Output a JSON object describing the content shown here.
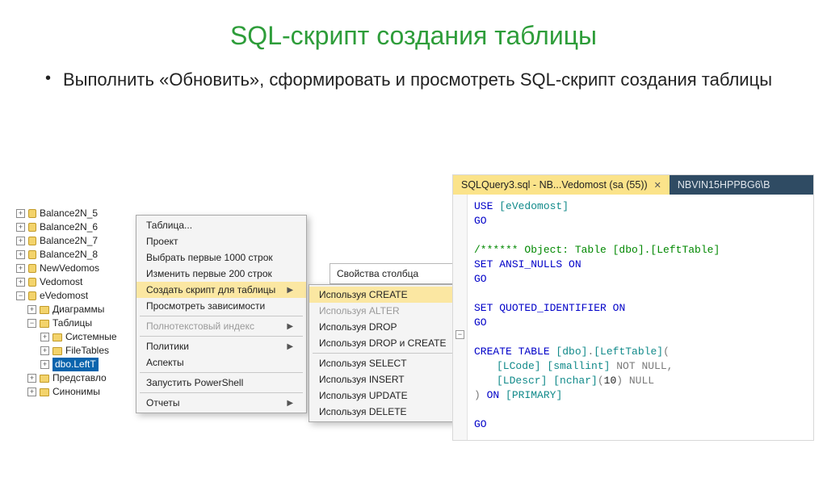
{
  "title": "SQL-скрипт создания таблицы",
  "bullet": "Выполнить «Обновить», сформировать и просмотреть SQL-скрипт создания таблицы",
  "tree": {
    "n0": "Balance2N_5",
    "n1": "Balance2N_6",
    "n2": "Balance2N_7",
    "n3": "Balance2N_8",
    "n4": "NewVedomos",
    "n5": "Vedomost",
    "n6": "eVedomost",
    "n7": "Диаграммы",
    "n8": "Таблицы",
    "n9": "Системные",
    "n10": "FileTables",
    "n11": "dbo.LeftT",
    "n12": "Представло",
    "n13": "Синонимы"
  },
  "colprops": "Свойства столбца",
  "menu1": {
    "i0": "Таблица...",
    "i1": "Проект",
    "i2": "Выбрать первые 1000 строк",
    "i3": "Изменить первые 200 строк",
    "i4": "Создать скрипт для таблицы",
    "i5": "Просмотреть зависимости",
    "i6": "Полнотекстовый индекс",
    "i7": "Политики",
    "i8": "Аспекты",
    "i9": "Запустить PowerShell",
    "i10": "Отчеты"
  },
  "menu2": {
    "i0": "Используя CREATE",
    "i1": "Используя ALTER",
    "i2": "Используя DROP",
    "i3": "Используя DROP и CREATE",
    "i4": "Используя SELECT",
    "i5": "Используя INSERT",
    "i6": "Используя UPDATE",
    "i7": "Используя DELETE"
  },
  "editor": {
    "tab1": "SQLQuery3.sql - NB...Vedomost (sa (55))",
    "tab2": "NBVIN15HPPBG6\\B",
    "lines": {
      "l0a": "USE ",
      "l0b": "[eVedomost]",
      "l1": "GO",
      "l2a": "/****** Object:  Table [dbo].[LeftTable]",
      "l3a": "SET ",
      "l3b": "ANSI_NULLS ",
      "l3c": "ON",
      "l4": "GO",
      "l5a": "SET ",
      "l5b": "QUOTED_IDENTIFIER ",
      "l5c": "ON",
      "l6": "GO",
      "l7a": "CREATE ",
      "l7b": "TABLE ",
      "l7c": "[dbo]",
      "l7d": ".",
      "l7e": "[LeftTable]",
      "l7f": "(",
      "l8a": "[LCode] [smallint] ",
      "l8b": "NOT NULL",
      "l8c": ",",
      "l9a": "[LDescr] [nchar]",
      "l9b": "(",
      "l9c": "10",
      "l9d": ") ",
      "l9e": "NULL",
      "l10a": ")",
      "l10b": " ON ",
      "l10c": "[PRIMARY]",
      "l11": "GO"
    }
  }
}
